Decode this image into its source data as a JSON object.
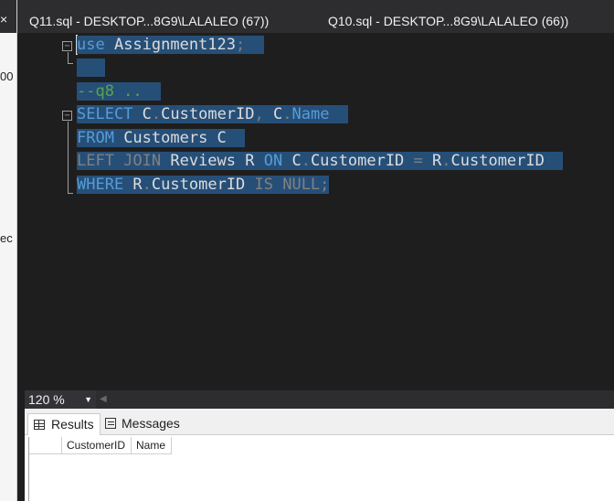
{
  "left_panel": {
    "close_glyph": "×",
    "fragment_top": "00",
    "fragment_mid": "ec"
  },
  "tabs": [
    {
      "label": "Q11.sql - DESKTOP...8G9\\LALALEO (67))"
    },
    {
      "label": "Q10.sql - DESKTOP...8G9\\LALALEO (66))"
    }
  ],
  "editor": {
    "lines": {
      "l1_kw": "use",
      "l1_db": " Assignment123",
      "l1_semi": ";",
      "l3_comment": "--q8 ..",
      "l4_kw": "SELECT",
      "l4_a": " C",
      "l4_dot1": ".",
      "l4_b": "CustomerID",
      "l4_comma": ",",
      "l4_c": " C",
      "l4_dot2": ".",
      "l4_d": "Name",
      "l5_kw": "FROM",
      "l5_rest": " Customers C",
      "l6_kw1": "LEFT JOIN",
      "l6_a": " Reviews R ",
      "l6_on": "ON",
      "l6_b": " C",
      "l6_dot1": ".",
      "l6_c": "CustomerID ",
      "l6_eq": "=",
      "l6_d": " R",
      "l6_dot2": ".",
      "l6_e": "CustomerID",
      "l7_kw": "WHERE",
      "l7_a": " R",
      "l7_dot": ".",
      "l7_b": "CustomerID ",
      "l7_is": "IS NULL",
      "l7_semi": ";"
    }
  },
  "zoom": {
    "value": "120 %"
  },
  "results": {
    "tabs": [
      {
        "label": "Results"
      },
      {
        "label": "Messages"
      }
    ],
    "columns": [
      "CustomerID",
      "Name"
    ]
  },
  "colors": {
    "keyword": "#569cd6",
    "comment": "#57a64a",
    "selection": "#264f78"
  }
}
